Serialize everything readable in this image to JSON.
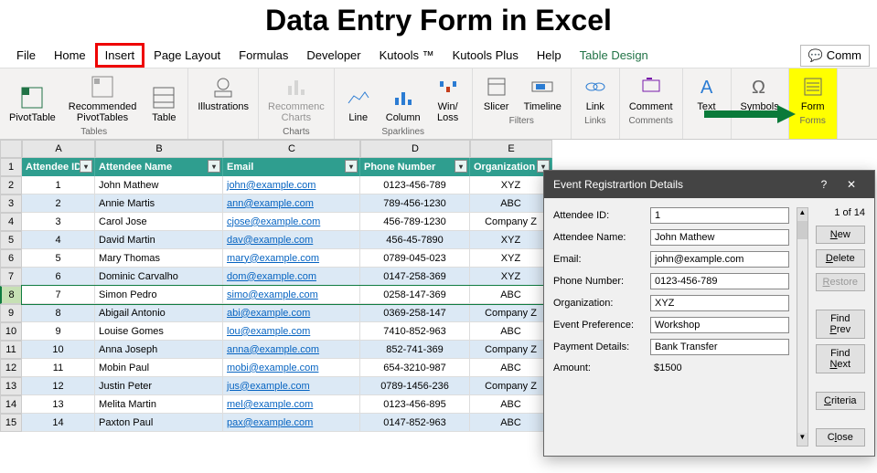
{
  "title": "Data Entry Form in Excel",
  "menu": {
    "file": "File",
    "home": "Home",
    "insert": "Insert",
    "page_layout": "Page Layout",
    "formulas": "Formulas",
    "developer": "Developer",
    "kutools": "Kutools ™",
    "kutools_plus": "Kutools Plus",
    "help": "Help",
    "table_design": "Table Design",
    "comments": "Comm"
  },
  "ribbon": {
    "tables": {
      "label": "Tables",
      "pivot": "PivotTable",
      "rec_pivot": "Recommended\nPivotTables",
      "table": "Table"
    },
    "illustrations": "Illustrations",
    "charts": {
      "label": "Charts",
      "rec_charts": "Recommenc\nCharts"
    },
    "sparklines": {
      "label": "Sparklines",
      "line": "Line",
      "column": "Column",
      "winloss": "Win/\nLoss"
    },
    "filters": {
      "label": "Filters",
      "slicer": "Slicer",
      "timeline": "Timeline"
    },
    "links": {
      "label": "Links",
      "link": "Link"
    },
    "comments": {
      "label": "Comments",
      "comment": "Comment"
    },
    "text": "Text",
    "symbols": "Symbols",
    "forms": {
      "label": "Forms",
      "form": "Form"
    }
  },
  "cols": {
    "A": "A",
    "B": "B",
    "C": "C",
    "D": "D",
    "E": "E"
  },
  "col_widths": {
    "A": 80,
    "B": 140,
    "C": 150,
    "D": 120,
    "E": 90
  },
  "headers": {
    "A": "Attendee ID",
    "B": "Attendee Name",
    "C": "Email",
    "D": "Phone Number",
    "E": "Organization"
  },
  "rows": [
    {
      "n": 1
    },
    {
      "n": 2,
      "A": "1",
      "B": "John Mathew",
      "C": "john@example.com",
      "D": "0123-456-789",
      "E": "XYZ"
    },
    {
      "n": 3,
      "A": "2",
      "B": "Annie Martis",
      "C": "ann@example.com",
      "D": "789-456-1230",
      "E": "ABC"
    },
    {
      "n": 4,
      "A": "3",
      "B": "Carol Jose",
      "C": "cjose@example.com",
      "D": "456-789-1230",
      "E": "Company Z"
    },
    {
      "n": 5,
      "A": "4",
      "B": "David Martin",
      "C": "dav@example.com",
      "D": "456-45-7890",
      "E": "XYZ"
    },
    {
      "n": 6,
      "A": "5",
      "B": "Mary Thomas",
      "C": "mary@example.com",
      "D": "0789-045-023",
      "E": "XYZ"
    },
    {
      "n": 7,
      "A": "6",
      "B": "Dominic  Carvalho",
      "C": "dom@example.com",
      "D": "0147-258-369",
      "E": "XYZ"
    },
    {
      "n": 8,
      "A": "7",
      "B": "Simon Pedro",
      "C": "simo@example.com",
      "D": "0258-147-369",
      "E": "ABC",
      "sel": true
    },
    {
      "n": 9,
      "A": "8",
      "B": "Abigail Antonio",
      "C": "abi@example.com",
      "D": "0369-258-147",
      "E": "Company Z"
    },
    {
      "n": 10,
      "A": "9",
      "B": "Louise Gomes",
      "C": "lou@example.com",
      "D": "7410-852-963",
      "E": "ABC"
    },
    {
      "n": 11,
      "A": "10",
      "B": "Anna Joseph",
      "C": "anna@example.com",
      "D": "852-741-369",
      "E": "Company Z"
    },
    {
      "n": 12,
      "A": "11",
      "B": "Mobin Paul",
      "C": "mobi@example.com",
      "D": "654-3210-987",
      "E": "ABC"
    },
    {
      "n": 13,
      "A": "12",
      "B": "Justin Peter",
      "C": "jus@example.com",
      "D": "0789-1456-236",
      "E": "Company Z"
    },
    {
      "n": 14,
      "A": "13",
      "B": "Melita Martin",
      "C": "mel@example.com",
      "D": "0123-456-895",
      "E": "ABC"
    },
    {
      "n": 15,
      "A": "14",
      "B": "Paxton Paul",
      "C": "pax@example.com",
      "D": "0147-852-963",
      "E": "ABC"
    }
  ],
  "dialog": {
    "title": "Event Registrartion Details",
    "count": "1 of 14",
    "fields": {
      "attendee_id": {
        "label": "Attendee ID:",
        "value": "1"
      },
      "attendee_name": {
        "label": "Attendee Name:",
        "value": "John Mathew"
      },
      "email": {
        "label": "Email:",
        "value": "john@example.com"
      },
      "phone": {
        "label": "Phone Number:",
        "value": "0123-456-789"
      },
      "org": {
        "label": "Organization:",
        "value": "XYZ"
      },
      "event_pref": {
        "label": "Event Preference:",
        "value": "Workshop"
      },
      "payment": {
        "label": "Payment Details:",
        "value": "Bank Transfer"
      },
      "amount": {
        "label": "Amount:",
        "value": "$1500"
      }
    },
    "buttons": {
      "new": "New",
      "delete": "Delete",
      "restore": "Restore",
      "find_prev": "Find Prev",
      "find_next": "Find Next",
      "criteria": "Criteria",
      "close": "Close"
    }
  }
}
